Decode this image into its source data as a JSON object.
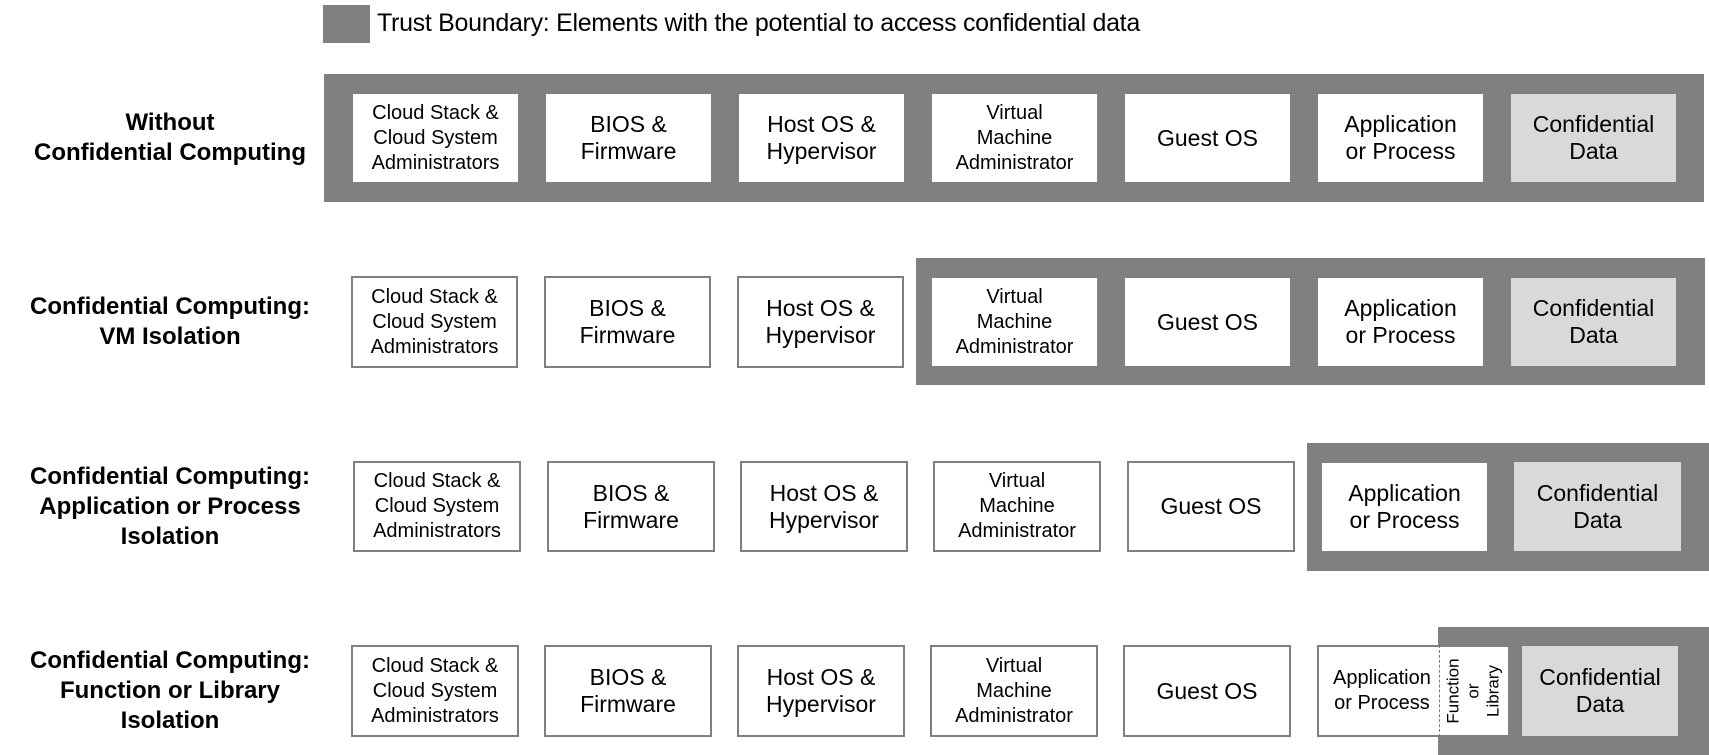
{
  "legend": {
    "label": "Trust Boundary: Elements with the potential to access confidential data",
    "swatch_color": "#808080"
  },
  "colors": {
    "boundary": "#808080",
    "box_fill": "#ffffff",
    "confidential_fill": "#d9d9d9",
    "box_outline": "#7f7f7f"
  },
  "elements": [
    "Cloud Stack &\nCloud System\nAdministrators",
    "BIOS &\nFirmware",
    "Host OS &\nHypervisor",
    "Virtual\nMachine\nAdministrator",
    "Guest OS",
    "Application\nor Process",
    "Confidential\nData"
  ],
  "function_library_label": "Function\nor Library",
  "rows": [
    {
      "label": "Without\nConfidential Computing",
      "trusted_from_index": 0
    },
    {
      "label": "Confidential Computing:\nVM Isolation",
      "trusted_from_index": 3
    },
    {
      "label": "Confidential Computing:\nApplication or Process\nIsolation",
      "trusted_from_index": 5
    },
    {
      "label": "Confidential Computing:\nFunction or Library\nIsolation",
      "trusted_from_index": "function-or-library"
    }
  ]
}
